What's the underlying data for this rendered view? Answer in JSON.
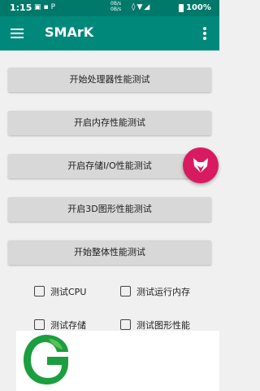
{
  "status_bar": {
    "time": "1:15",
    "net_up": "0B/s",
    "net_down": "0B/s",
    "battery": "100%",
    "icons": [
      "sim-card-icon",
      "notification-icon",
      "p-icon",
      "vibrate-icon",
      "wifi-icon",
      "signal-icon",
      "battery-icon"
    ]
  },
  "app_bar": {
    "title": "SMArK",
    "menu_icon": "hamburger-menu-icon",
    "overflow_icon": "more-vert-icon"
  },
  "buttons": [
    {
      "label": "开始处理器性能测试"
    },
    {
      "label": "开启内存性能测试"
    },
    {
      "label": "开启存储I/O性能测试"
    },
    {
      "label": "开启3D图形性能测试"
    },
    {
      "label": "开始整体性能测试"
    }
  ],
  "checkboxes": [
    {
      "label": "测试CPU",
      "checked": false
    },
    {
      "label": "测试运行内存",
      "checked": false
    },
    {
      "label": "测试存储",
      "checked": false
    },
    {
      "label": "测试图形性能",
      "checked": false
    }
  ],
  "fab": {
    "icon": "fox-face-icon"
  },
  "logo": {
    "icon": "green-leaf-logo-icon"
  },
  "colors": {
    "status_bar": "#00796b",
    "app_bar": "#00897b",
    "background": "#f0f0f0",
    "button": "#d8d8d8",
    "fab": "#d81b60",
    "logo_green": "#1b9e3e"
  }
}
